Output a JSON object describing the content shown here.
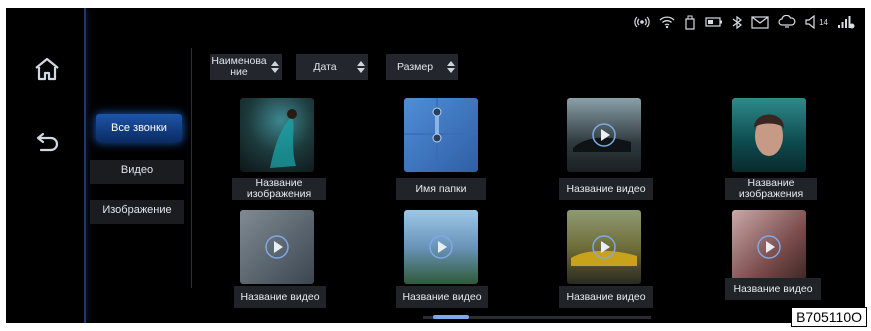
{
  "status_bar": {
    "icons": [
      "hotspot-icon",
      "wifi-icon",
      "usb-icon",
      "battery-icon",
      "bluetooth-icon",
      "message-icon",
      "cloud-icon",
      "volume-icon",
      "signal-icon"
    ],
    "volume_level": "14"
  },
  "nav": {
    "home_icon": "home-icon",
    "back_icon": "back-icon"
  },
  "categories": {
    "selected": "Все звонки",
    "video": "Видео",
    "image": "Изображение"
  },
  "sort": {
    "name": "Наименова ние",
    "date": "Дата",
    "size": "Размер"
  },
  "items": [
    {
      "caption": "Название изображения",
      "type": "image"
    },
    {
      "caption": "Имя папки",
      "type": "folder"
    },
    {
      "caption": "Название видео",
      "type": "video"
    },
    {
      "caption": "Название изображения",
      "type": "image"
    },
    {
      "caption": "Название видео",
      "type": "video"
    },
    {
      "caption": "Название видео",
      "type": "video"
    },
    {
      "caption": "Название видео",
      "type": "video"
    },
    {
      "caption": "Название видео",
      "type": "video"
    }
  ],
  "figure_code": "B705110O",
  "colors": {
    "accent": "#1b62c7",
    "background": "#000000"
  }
}
